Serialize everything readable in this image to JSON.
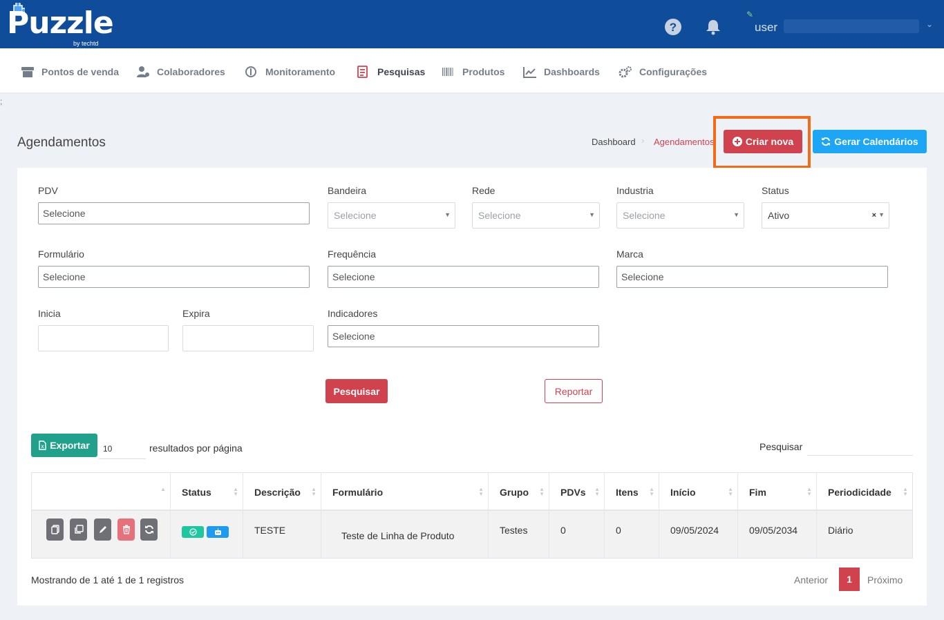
{
  "header": {
    "logo_text": "Puzzle",
    "logo_sub": "by techtd",
    "user_label": "user"
  },
  "nav": {
    "items": [
      {
        "label": "Pontos de venda",
        "icon": "store-icon"
      },
      {
        "label": "Colaboradores",
        "icon": "users-icon"
      },
      {
        "label": "Monitoramento",
        "icon": "monitor-icon"
      },
      {
        "label": "Pesquisas",
        "icon": "survey-icon"
      },
      {
        "label": "Produtos",
        "icon": "barcode-icon"
      },
      {
        "label": "Dashboards",
        "icon": "chart-line-icon"
      },
      {
        "label": "Configurações",
        "icon": "cogs-icon"
      }
    ],
    "active": "Pesquisas"
  },
  "stray_text": ";",
  "page": {
    "title": "Agendamentos",
    "breadcrumb": [
      "Dashboard",
      "Agendamentos"
    ],
    "create_label": "Criar nova",
    "calendar_label": "Gerar Calendários"
  },
  "filters": {
    "pdv": {
      "label": "PDV",
      "value": "Selecione"
    },
    "bandeira": {
      "label": "Bandeira",
      "value": "Selecione"
    },
    "rede": {
      "label": "Rede",
      "value": "Selecione"
    },
    "industria": {
      "label": "Industria",
      "value": "Selecione"
    },
    "status": {
      "label": "Status",
      "value": "Ativo"
    },
    "formulario": {
      "label": "Formulário",
      "value": "Selecione"
    },
    "frequencia": {
      "label": "Frequência",
      "value": "Selecione"
    },
    "marca": {
      "label": "Marca",
      "value": "Selecione"
    },
    "inicia": {
      "label": "Inicia",
      "value": ""
    },
    "expira": {
      "label": "Expira",
      "value": ""
    },
    "indicadores": {
      "label": "Indicadores",
      "value": "Selecione"
    },
    "search_label": "Pesquisar",
    "report_label": "Reportar"
  },
  "table_controls": {
    "export_label": "Exportar",
    "per_page": "10",
    "per_page_label": "resultados por página",
    "search_label": "Pesquisar"
  },
  "table": {
    "headers": [
      "",
      "Status",
      "Descrição",
      "Formulário",
      "Grupo",
      "PDVs",
      "Itens",
      "Início",
      "Fim",
      "Periodicidade"
    ],
    "rows": [
      {
        "descricao": "TESTE",
        "formulario": "Teste de Linha de Produto",
        "grupo": "Testes",
        "pdvs": "0",
        "itens": "0",
        "inicio": "09/05/2024",
        "fim": "09/05/2034",
        "periodicidade": "Diário"
      }
    ]
  },
  "footer": {
    "showing": "Mostrando de 1 até 1 de 1 registros",
    "prev": "Anterior",
    "current_page": "1",
    "next": "Próximo"
  },
  "colors": {
    "header_bg": "#0f4c9a",
    "primary_red": "#d0424e",
    "calendar_blue": "#1da6f5",
    "export_green": "#21a18b",
    "highlight_orange": "#f36b19"
  }
}
